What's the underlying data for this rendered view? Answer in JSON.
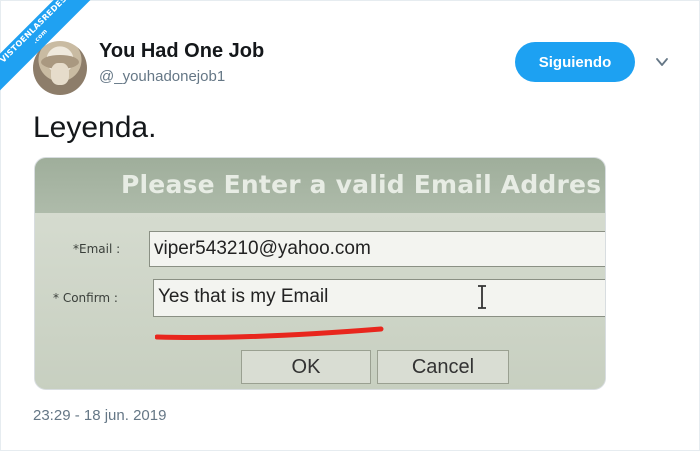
{
  "watermark": {
    "line1": "VISTOENLASREDES",
    "line2": ".com"
  },
  "tweet": {
    "author_name": "You Had One Job",
    "author_handle": "@_youhadonejob1",
    "follow_label": "Siguiendo",
    "text": "Leyenda.",
    "timestamp": "23:29 - 18 jun. 2019"
  },
  "media": {
    "header": "Please Enter a valid Email Addres",
    "email_label": "*Email :",
    "email_value": "viper543210@yahoo.com",
    "confirm_label": "* Confirm :",
    "confirm_value": "Yes that is my Email",
    "ok_label": "OK",
    "cancel_label": "Cancel"
  },
  "colors": {
    "accent": "#1da1f2",
    "secondary_text": "#657786",
    "annotation_red": "#e8261d"
  },
  "icons": {
    "more": "chevron-down-icon",
    "text_cursor": "i-beam-cursor-icon"
  }
}
